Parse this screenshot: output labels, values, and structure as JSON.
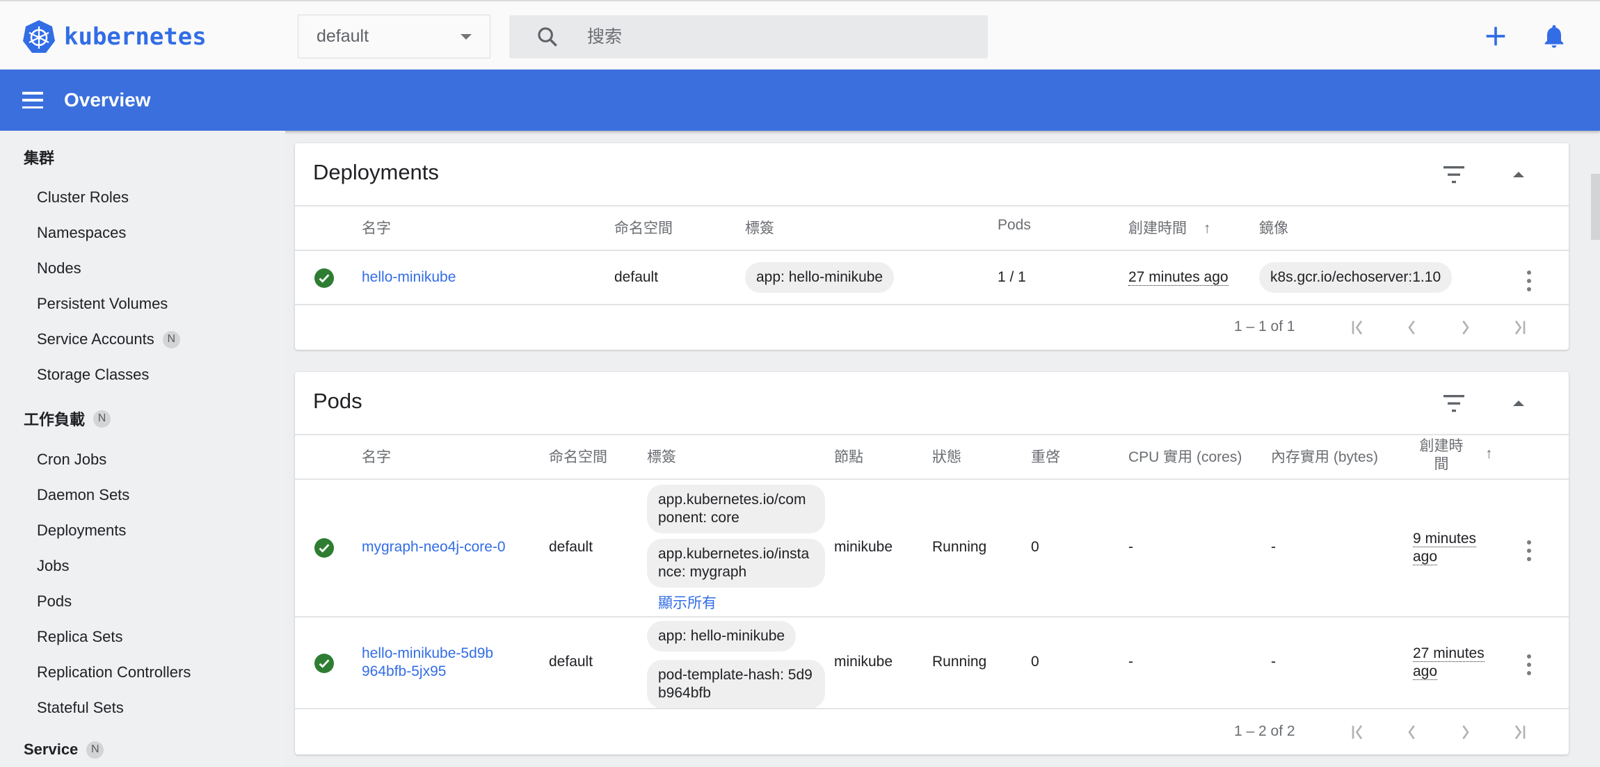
{
  "header": {
    "logo_text": "kubernetes",
    "namespace": "default",
    "search_placeholder": "搜索"
  },
  "toolbar": {
    "title": "Overview"
  },
  "sidebar": {
    "sections": [
      {
        "label": "集群",
        "badge": null,
        "items": [
          "Cluster Roles",
          "Namespaces",
          "Nodes",
          "Persistent Volumes",
          "Service Accounts",
          "Storage Classes"
        ],
        "item_badges": {
          "Service Accounts": "N"
        }
      },
      {
        "label": "工作負載",
        "badge": "N",
        "items": [
          "Cron Jobs",
          "Daemon Sets",
          "Deployments",
          "Jobs",
          "Pods",
          "Replica Sets",
          "Replication Controllers",
          "Stateful Sets"
        ]
      },
      {
        "label": "Service",
        "badge": "N",
        "items": []
      }
    ]
  },
  "deployments": {
    "title": "Deployments",
    "columns": [
      "名字",
      "命名空間",
      "標簽",
      "Pods",
      "創建時間",
      "鏡像"
    ],
    "sort_column": "創建時間",
    "rows": [
      {
        "status": "ok",
        "name": "hello-minikube",
        "namespace": "default",
        "labels": [
          "app: hello-minikube"
        ],
        "pods": "1 / 1",
        "created": "27 minutes ago",
        "image": "k8s.gcr.io/echoserver:1.10"
      }
    ],
    "pagination": "1 – 1 of 1"
  },
  "pods": {
    "title": "Pods",
    "columns": [
      "名字",
      "命名空間",
      "標簽",
      "節點",
      "狀態",
      "重啓",
      "CPU 實用 (cores)",
      "內存實用 (bytes)",
      "創建時間"
    ],
    "sort_column": "創建時間",
    "rows": [
      {
        "status": "ok",
        "name": "mygraph-neo4j-core-0",
        "namespace": "default",
        "labels": [
          "app.kubernetes.io/component: core",
          "app.kubernetes.io/instance: mygraph"
        ],
        "show_all": "顯示所有",
        "node": "minikube",
        "state": "Running",
        "restarts": "0",
        "cpu": "-",
        "memory": "-",
        "created": "9 minutes ago"
      },
      {
        "status": "ok",
        "name": "hello-minikube-5d9b964bfb-5jx95",
        "namespace": "default",
        "labels": [
          "app: hello-minikube",
          "pod-template-hash: 5d9b964bfb"
        ],
        "node": "minikube",
        "state": "Running",
        "restarts": "0",
        "cpu": "-",
        "memory": "-",
        "created": "27 minutes ago"
      }
    ],
    "pagination": "1 – 2 of 2"
  },
  "colors": {
    "brand": "#326de6",
    "toolbar": "#3a6fdd",
    "success": "#2e7d32"
  }
}
